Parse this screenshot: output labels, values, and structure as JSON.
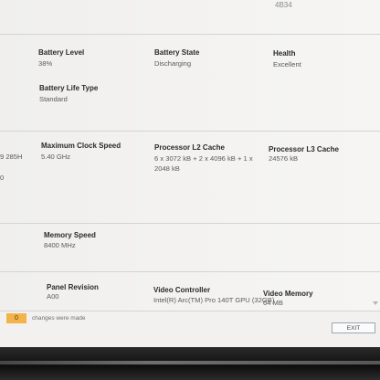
{
  "top": {
    "partial_value": "4B34"
  },
  "battery": {
    "level_label": "Battery Level",
    "level_value": "38%",
    "state_label": "Battery State",
    "state_value": "Discharging",
    "health_label": "Health",
    "health_value": "Excellent",
    "life_type_label": "Battery Life Type",
    "life_type_value": "Standard"
  },
  "processor": {
    "left_cut_value_1": "9 285H",
    "left_cut_value_2": "0",
    "max_clock_label": "Maximum Clock Speed",
    "max_clock_value": "5.40 GHz",
    "l2_label": "Processor L2 Cache",
    "l2_value": "6 x 3072  kB + 2 x 4096  kB + 1 x 2048 kB",
    "l3_label": "Processor L3 Cache",
    "l3_value": "24576 kB"
  },
  "memory": {
    "speed_label": "Memory Speed",
    "speed_value": "8400 MHz"
  },
  "display": {
    "panel_revision_label": "Panel Revision",
    "panel_revision_value": "A00",
    "video_controller_label": "Video Controller",
    "video_controller_value": "Intel(R) Arc(TM) Pro 140T GPU (32GB)",
    "video_memory_label": "Video Memory",
    "video_memory_value": "64 MB"
  },
  "footer": {
    "changes_count": "0",
    "changes_text": "changes were made",
    "exit_label": "EXIT"
  },
  "colors": {
    "accent_counter": "#f3b34a",
    "separator": "#d4d4d4"
  }
}
